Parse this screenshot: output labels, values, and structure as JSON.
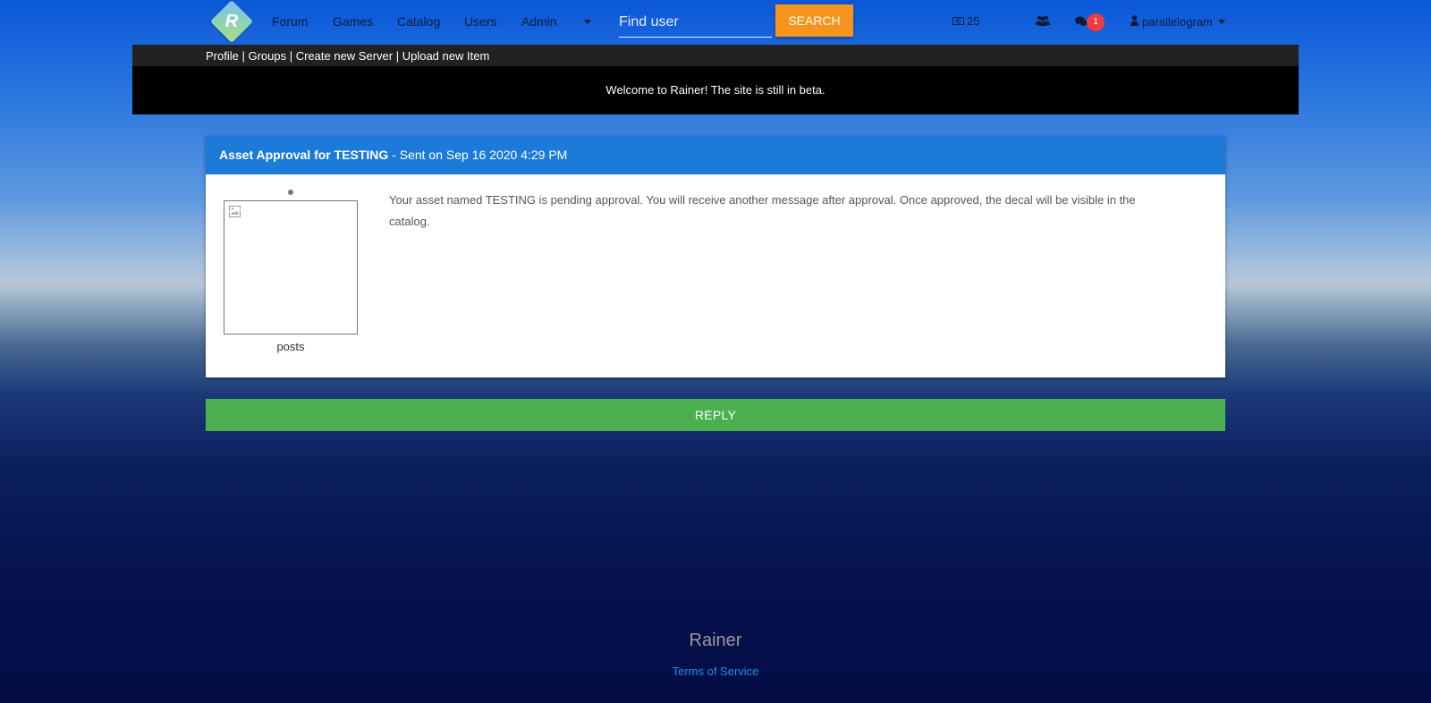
{
  "nav": {
    "logo_letter": "R",
    "links": [
      "Forum",
      "Games",
      "Catalog",
      "Users",
      "Admin"
    ],
    "search_placeholder": "Find user",
    "search_button": "SEARCH",
    "currency": "25",
    "messages_badge": "1",
    "username": "parallelogram"
  },
  "subnav": {
    "links": [
      "Profile",
      "Groups",
      "Create new Server",
      "Upload new Item"
    ],
    "separator": " | "
  },
  "banner": {
    "text": "Welcome to Rainer! The site is still in beta."
  },
  "message": {
    "subject": "Asset Approval for TESTING",
    "sent_info": " - Sent on Sep 16 2020 4:29 PM",
    "author_stat": "posts",
    "body": "Your asset named TESTING is pending approval. You will receive another message after approval. Once approved, the decal will be visible in the catalog."
  },
  "reply_button": "REPLY",
  "footer": {
    "brand": "Rainer",
    "terms_link": "Terms of Service"
  },
  "colors": {
    "search_button": "#f7941d",
    "card_header": "#1c7bd8",
    "reply_button": "#4caf50",
    "badge": "#ee3b3b",
    "footer_link": "#1e8ff0"
  },
  "icons": [
    "logo-icon",
    "cash-icon",
    "friends-icon",
    "chat-icon",
    "user-icon",
    "caret-down-icon",
    "broken-image-icon"
  ]
}
